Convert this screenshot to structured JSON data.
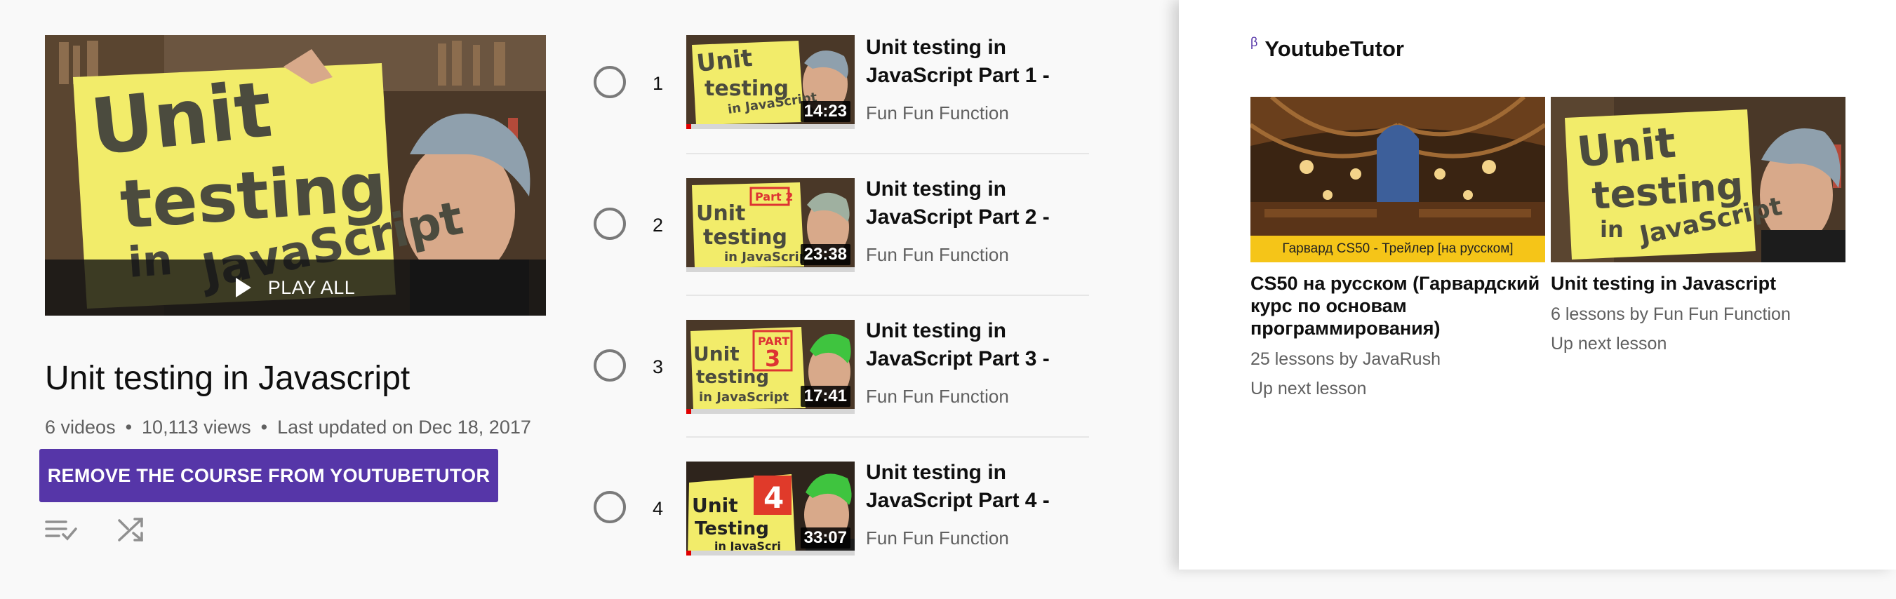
{
  "playlist": {
    "play_all_label": "PLAY ALL",
    "title": "Unit testing in Javascript",
    "video_count": "6 videos",
    "views": "10,113 views",
    "last_updated": "Last updated on Dec 18, 2017",
    "remove_button_label": "REMOVE THE COURSE FROM YOUTUBETUTOR",
    "icons": [
      "playlist-check-icon",
      "shuffle-icon"
    ],
    "thumbnail_sign_text": [
      "Unit",
      "testing",
      "in",
      "JavaScript"
    ]
  },
  "videos": [
    {
      "index": "1",
      "title": "Unit testing in JavaScript Part 1 -",
      "channel": "Fun Fun Function",
      "duration": "14:23",
      "watched_fraction": 0.03
    },
    {
      "index": "2",
      "title": "Unit testing in JavaScript Part 2 -",
      "channel": "Fun Fun Function",
      "duration": "23:38",
      "watched_fraction": 0.0
    },
    {
      "index": "3",
      "title": "Unit testing in JavaScript Part 3 -",
      "channel": "Fun Fun Function",
      "duration": "17:41",
      "watched_fraction": 0.03
    },
    {
      "index": "4",
      "title": "Unit testing in JavaScript Part 4 -",
      "channel": "Fun Fun Function",
      "duration": "33:07",
      "watched_fraction": 0.03
    }
  ],
  "extension": {
    "beta_mark": "β",
    "name": "YoutubeTutor",
    "courses": [
      {
        "title": "CS50 на русском (Гарвардский курс по основам программирования)",
        "meta": "25 lessons by JavaRush",
        "next": "Up next lesson",
        "thumb_caption": "Гарвард CS50 - Трейлер [на русском]"
      },
      {
        "title": "Unit testing in Javascript",
        "meta": "6 lessons by Fun Fun Function",
        "next": "Up next lesson"
      }
    ]
  },
  "colors": {
    "accent": "#5636a8",
    "progress_red": "#e00000",
    "muted_text": "#606060",
    "caption_yellow": "#f5c518"
  }
}
